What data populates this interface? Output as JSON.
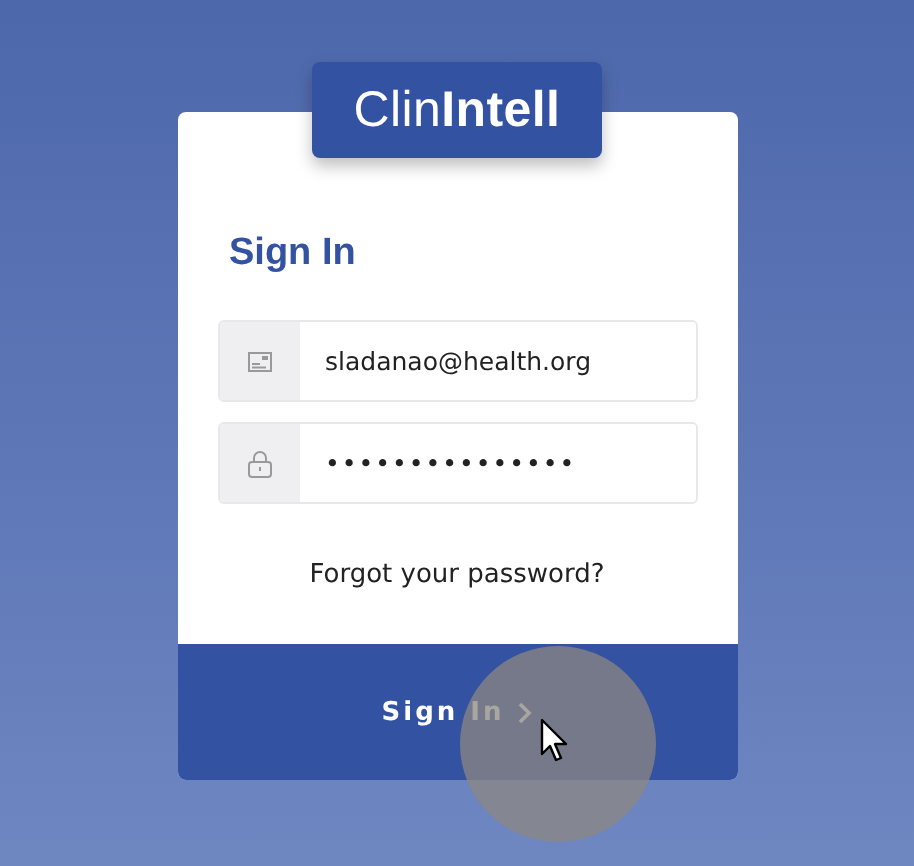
{
  "logo": "Clin**Intell**",
  "heading": "Sign In",
  "fields": [
    {
      "kind": "email",
      "value": "sladanao@health.org"
    },
    {
      "kind": "password",
      "value": "•••••••••••••••"
    }
  ],
  "forgot_link": "Forgot your password?",
  "submit_button": {
    "label": "Sign In"
  },
  "cursor": {
    "kind": "click"
  }
}
